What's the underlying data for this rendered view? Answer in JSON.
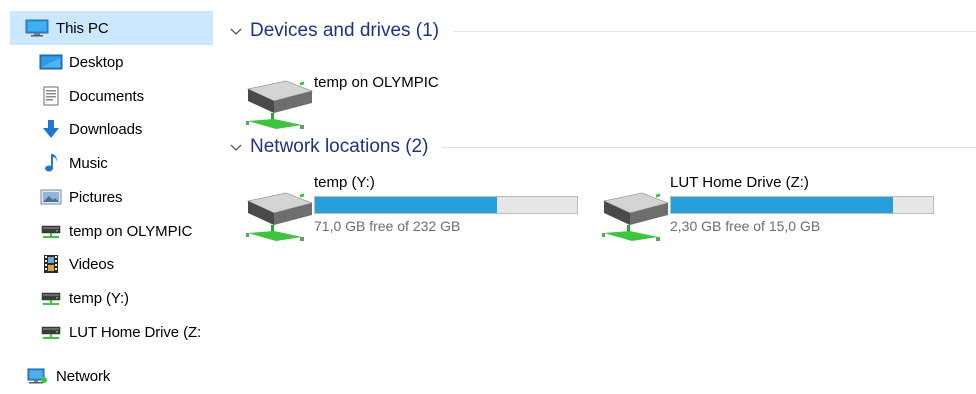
{
  "sidebar": {
    "items": [
      {
        "label": "This PC",
        "icon": "monitor-icon",
        "selected": true
      },
      {
        "label": "Desktop",
        "icon": "desktop-icon"
      },
      {
        "label": "Documents",
        "icon": "documents-icon"
      },
      {
        "label": "Downloads",
        "icon": "download-arrow-icon"
      },
      {
        "label": "Music",
        "icon": "music-note-icon"
      },
      {
        "label": "Pictures",
        "icon": "pictures-icon"
      },
      {
        "label": "temp on OLYMPIC",
        "icon": "network-drive-icon"
      },
      {
        "label": "Videos",
        "icon": "videos-icon"
      },
      {
        "label": "temp (Y:)",
        "icon": "network-drive-icon"
      },
      {
        "label": "LUT Home Drive (Z:",
        "icon": "network-drive-icon"
      },
      {
        "label": "Network",
        "icon": "network-icon"
      }
    ]
  },
  "groups": {
    "devices": {
      "title": "Devices and drives (1)"
    },
    "network": {
      "title": "Network locations (2)"
    }
  },
  "drives": {
    "olympic": {
      "name": "temp on OLYMPIC",
      "icon": "network-drive-icon"
    },
    "y": {
      "name": "temp (Y:)",
      "free_text": "71,0 GB free of 232 GB",
      "used_fraction": 0.694,
      "icon": "network-drive-icon"
    },
    "z": {
      "name": "LUT Home Drive (Z:)",
      "free_text": "2,30 GB free of 15,0 GB",
      "used_fraction": 0.847,
      "icon": "network-drive-icon"
    }
  },
  "colors": {
    "selection": "#cce8ff",
    "bar_fill": "#26a0da",
    "group_title": "#1e3287"
  }
}
